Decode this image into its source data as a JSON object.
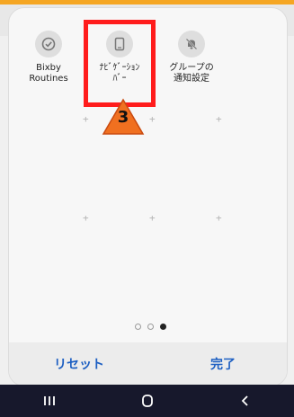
{
  "tiles": [
    {
      "label": "Bixby\nRoutines",
      "icon": "routine-check-icon"
    },
    {
      "label": "ﾅﾋﾞｹﾞｰｼｮﾝ\nﾊﾞｰ",
      "icon": "phone-icon"
    },
    {
      "label": "グループの\n通知設定",
      "icon": "bell-mute-icon"
    }
  ],
  "pager": {
    "total": 3,
    "active": 3
  },
  "footer": {
    "reset_label": "リセット",
    "done_label": "完了"
  },
  "annotation": {
    "step_number": "3",
    "highlight_color": "#ff1c1c"
  },
  "colors": {
    "accent_text": "#1d5fc2",
    "navbar": "#17182c"
  }
}
